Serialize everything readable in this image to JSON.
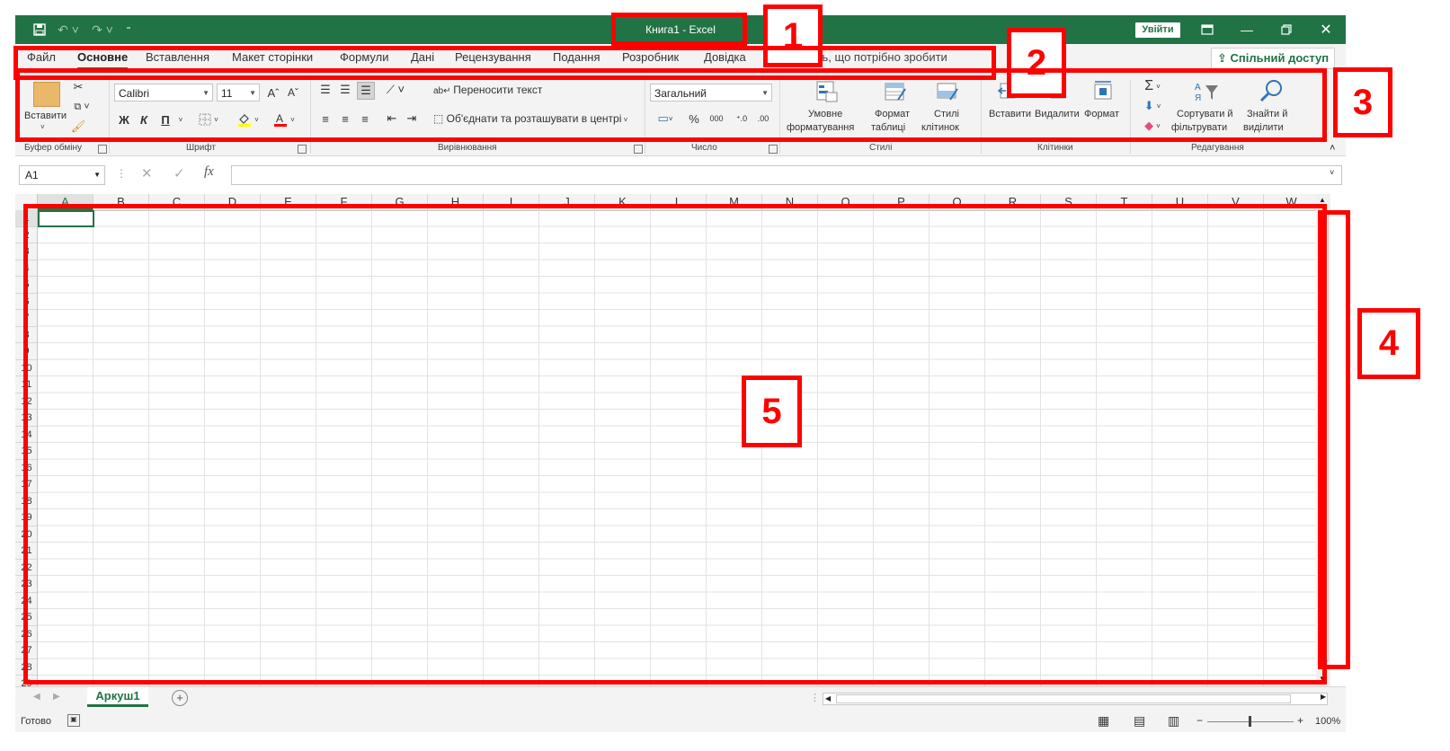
{
  "app": {
    "window_title": "Книга1  -  Excel",
    "signin_label": "Увійти",
    "share_label": "Спільний доступ",
    "tell_me": "жіть, що потрібно зробити"
  },
  "tabs": [
    "Файл",
    "Основне",
    "Вставлення",
    "Макет сторінки",
    "Формули",
    "Дані",
    "Рецензування",
    "Подання",
    "Розробник",
    "Довідка"
  ],
  "ribbon": {
    "clipboard": {
      "paste": "Вставити",
      "label": "Буфер обміну"
    },
    "font": {
      "name": "Calibri",
      "size": "11",
      "bold": "Ж",
      "italic": "К",
      "underline": "П",
      "grow": "Aˆ",
      "shrink": "Aˇ",
      "label": "Шрифт"
    },
    "alignment": {
      "wrap": "Переносити текст",
      "merge": "Об'єднати та розташувати в центрі",
      "label": "Вирівнювання"
    },
    "number": {
      "format": "Загальний",
      "percent": "%",
      "thousands": "000",
      "label": "Число"
    },
    "styles": {
      "conditional_1": "Умовне",
      "conditional_2": "форматування",
      "table_1": "Формат",
      "table_2": "таблиці",
      "cell_1": "Стилі",
      "cell_2": "клітинок",
      "label": "Стилі"
    },
    "cells": {
      "insert": "Вставити",
      "delete": "Видалити",
      "format": "Формат",
      "label": "Клітинки"
    },
    "editing": {
      "sort_1": "Сортувати й",
      "sort_2": "фільтрувати",
      "find_1": "Знайти й",
      "find_2": "виділити",
      "label": "Редагування"
    }
  },
  "formula_bar": {
    "name_box": "A1",
    "fx": "fx"
  },
  "columns": [
    "A",
    "B",
    "C",
    "D",
    "E",
    "F",
    "G",
    "H",
    "I",
    "J",
    "K",
    "L",
    "M",
    "N",
    "O",
    "P",
    "Q",
    "R",
    "S",
    "T",
    "U",
    "V",
    "W"
  ],
  "rows": [
    "1",
    "2",
    "3",
    "4",
    "5",
    "6",
    "7",
    "8",
    "9",
    "10",
    "11",
    "12",
    "13",
    "14",
    "15",
    "16",
    "17",
    "18",
    "19",
    "20",
    "21",
    "22",
    "23",
    "24",
    "25",
    "26",
    "27",
    "28",
    "29"
  ],
  "sheet": {
    "tab": "Аркуш1",
    "add": "+"
  },
  "status": {
    "ready": "Готово",
    "zoom": "100%"
  },
  "annotations": [
    "1",
    "2",
    "3",
    "4",
    "5"
  ]
}
